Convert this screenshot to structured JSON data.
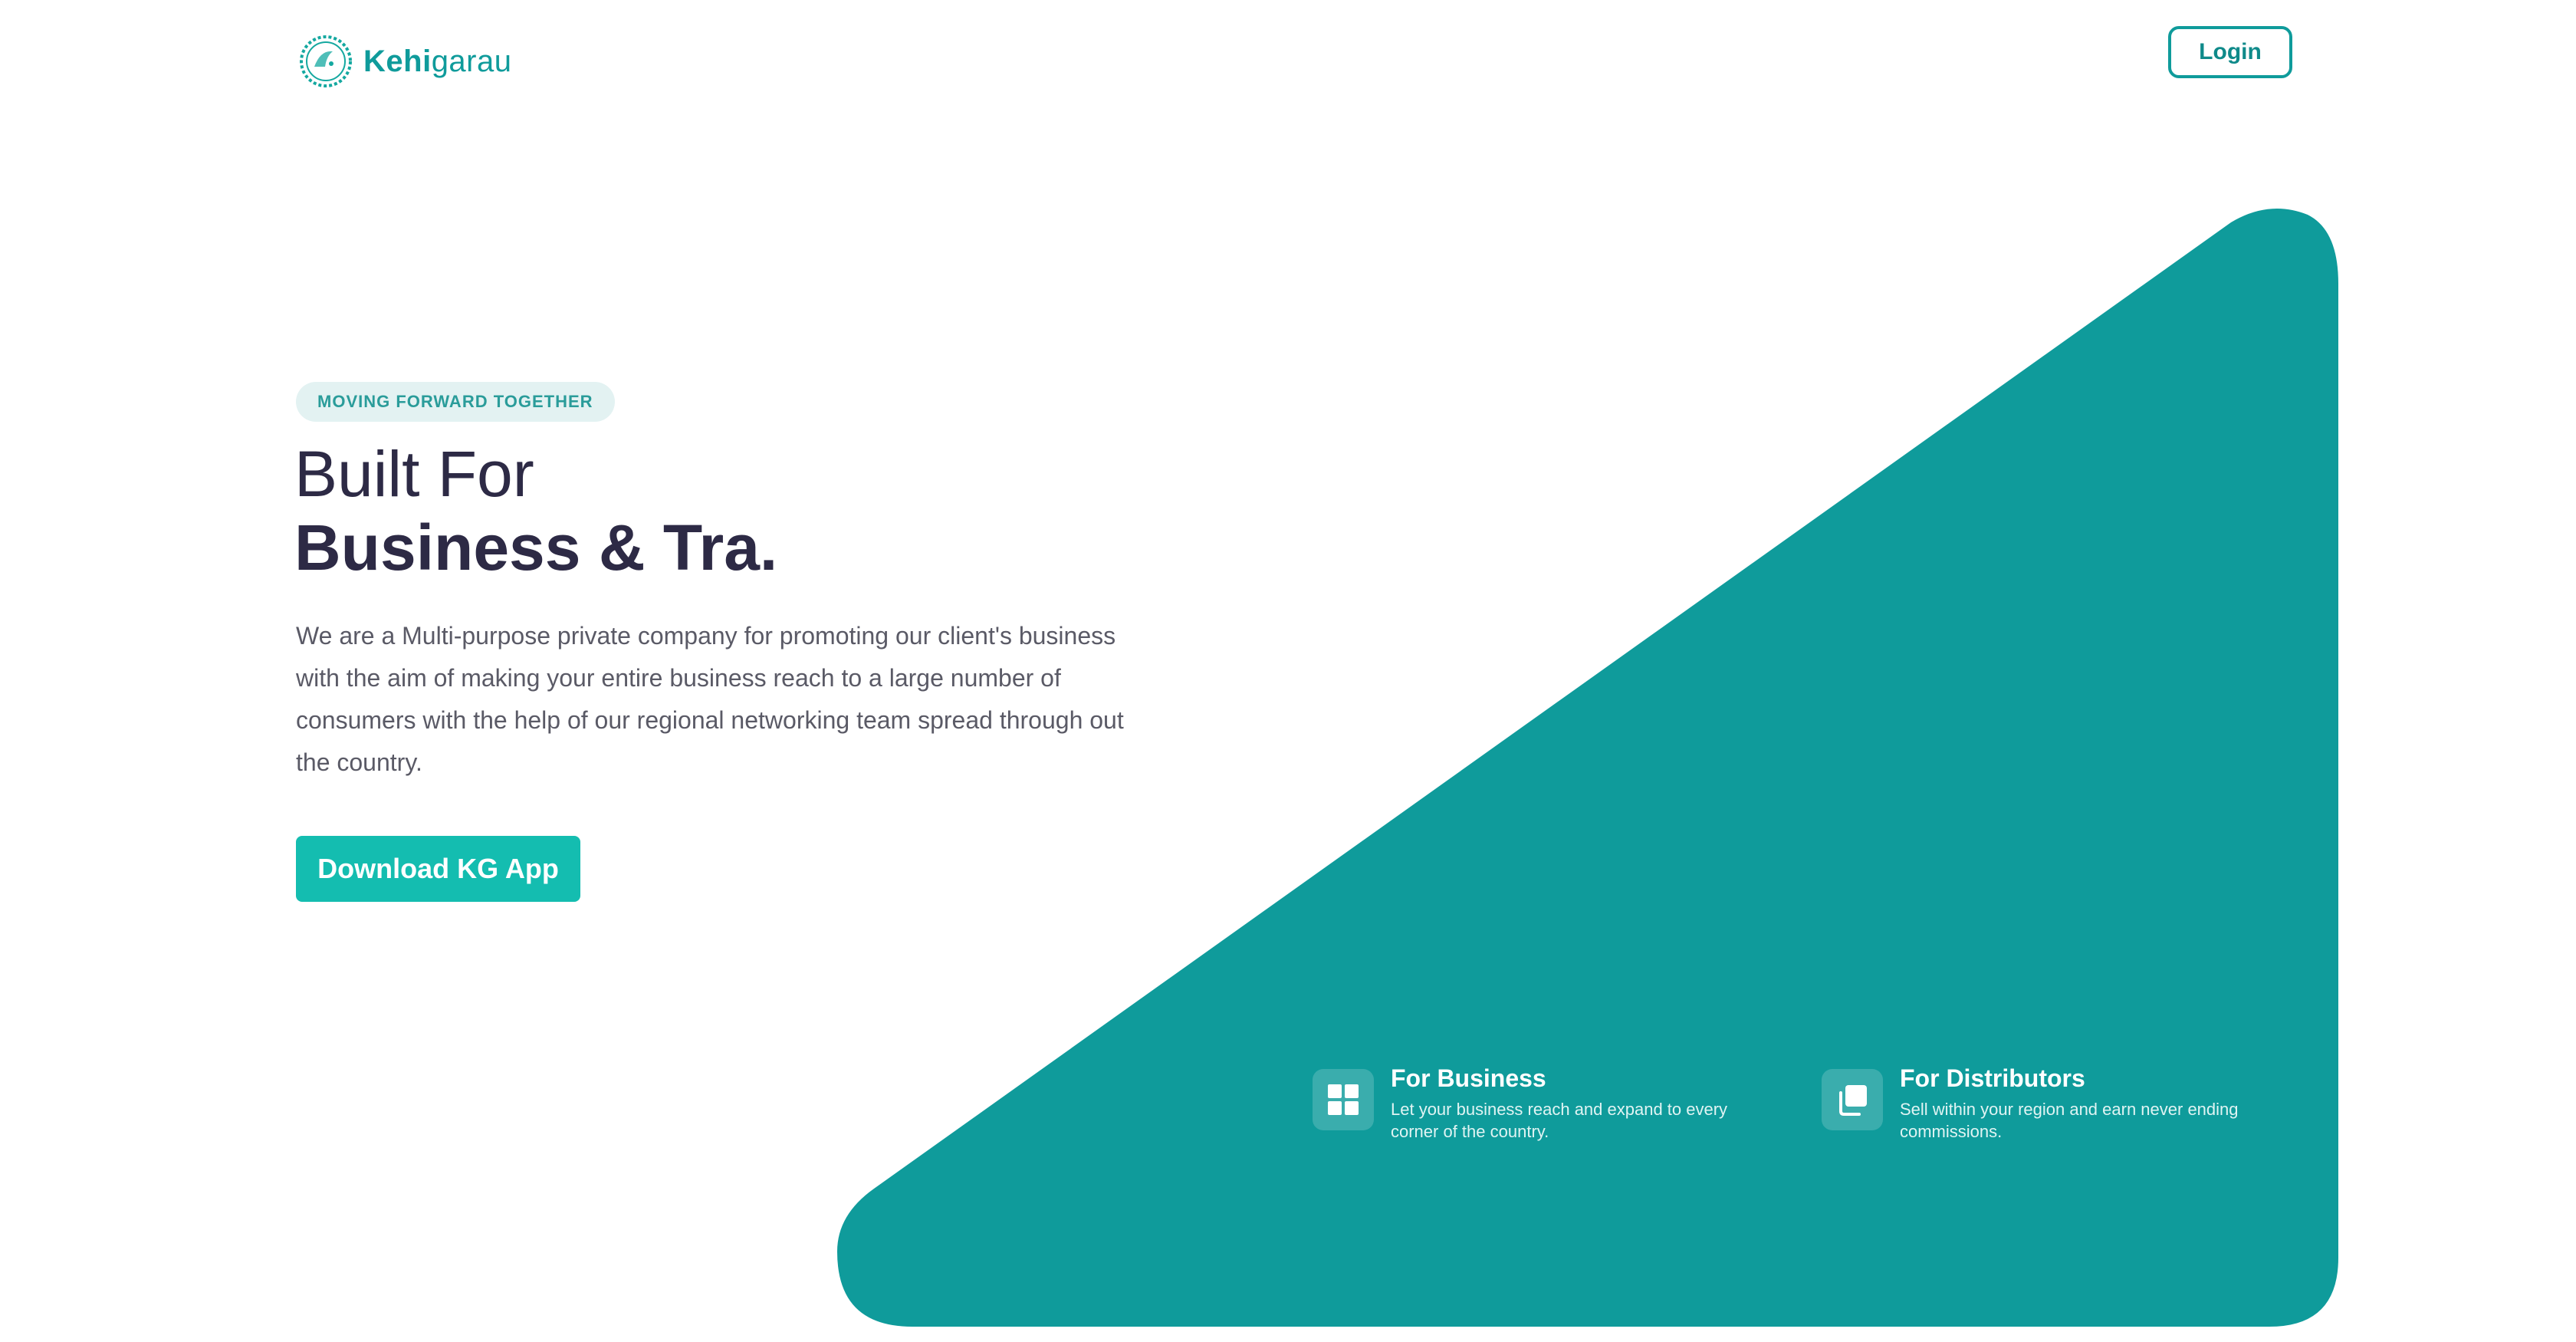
{
  "header": {
    "logo_bold": "Kehi",
    "logo_light": "garau",
    "login_label": "Login"
  },
  "hero": {
    "tagline": "MOVING FORWARD TOGETHER",
    "title_line1": "Built For",
    "title_line2": "Business & Tra.",
    "description": "We are a Multi-purpose private company for promoting our client's business with the aim of making your entire business reach to a large number of consumers with the help of our regional networking team spread through out the country.",
    "cta_label": "Download KG App"
  },
  "features": [
    {
      "title": "For Business",
      "description": "Let your business reach and expand to every corner of the country.",
      "icon": "grid-icon"
    },
    {
      "title": "For Distributors",
      "description": "Sell within your region and earn never ending commissions.",
      "icon": "copy-icon"
    }
  ],
  "colors": {
    "brand": "#0f9b9b",
    "teal_shape": "#0f9b9b",
    "cta": "#14bdb0",
    "heading": "#2d2a45",
    "body_text": "#5a5a66",
    "tagline_bg": "#e3f2f2"
  }
}
